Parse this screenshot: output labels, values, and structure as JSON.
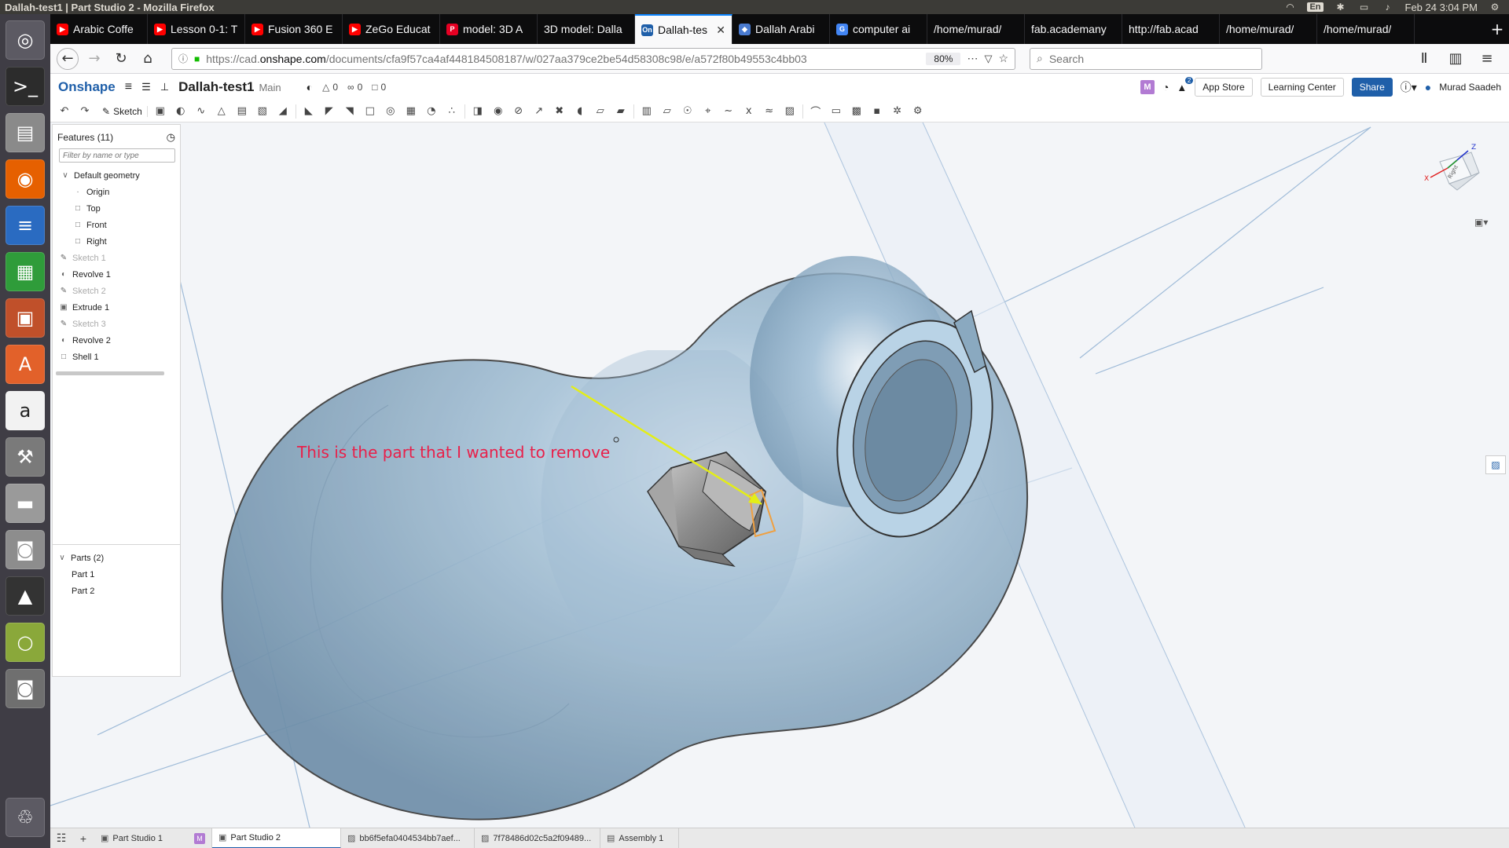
{
  "window": {
    "title": "Dallah-test1 | Part Studio 2 - Mozilla Firefox"
  },
  "tray": {
    "lang": "En",
    "datetime": "Feb 24  3:04 PM"
  },
  "tabs": [
    {
      "label": "Arabic Coffe",
      "favicon": "youtube-icon",
      "color": "#ff0000"
    },
    {
      "label": "Lesson 0-1: T",
      "favicon": "youtube-icon",
      "color": "#ff0000"
    },
    {
      "label": "Fusion 360 E",
      "favicon": "youtube-icon",
      "color": "#ff0000"
    },
    {
      "label": "ZeGo Educat",
      "favicon": "youtube-icon",
      "color": "#ff0000"
    },
    {
      "label": "model: 3D A",
      "favicon": "pinterest-icon",
      "color": "#e60023"
    },
    {
      "label": "3D model: Dalla",
      "favicon": "",
      "color": ""
    },
    {
      "label": "Dallah-tes",
      "favicon": "onshape-icon",
      "color": "#1f5fa9",
      "active": true
    },
    {
      "label": "Dallah Arabi",
      "favicon": "generic-icon",
      "color": "#4a7bd0"
    },
    {
      "label": "computer ai",
      "favicon": "google-icon",
      "color": "#4285f4"
    },
    {
      "label": "/home/murad/",
      "favicon": "",
      "color": ""
    },
    {
      "label": "fab.academany",
      "favicon": "",
      "color": ""
    },
    {
      "label": "http://fab.acad",
      "favicon": "",
      "color": ""
    },
    {
      "label": "/home/murad/",
      "favicon": "",
      "color": ""
    },
    {
      "label": "/home/murad/",
      "favicon": "",
      "color": ""
    }
  ],
  "nav": {
    "url_prefix": "https://cad.",
    "url_domain": "onshape.com",
    "url_rest": "/documents/cfa9f57ca4af448184508187/w/027aa379ce2be54d58308c98/e/a572f80b49553c4bb03",
    "zoom": "80%",
    "search_placeholder": "Search"
  },
  "onshape": {
    "logo": "Onshape",
    "doc_title": "Dallah-test1",
    "branch": "Main",
    "likes": "0",
    "links": "0",
    "copies": "0",
    "app_store": "App Store",
    "learning_center": "Learning Center",
    "share": "Share",
    "user": "Murad Saadeh",
    "m_badge": "M",
    "notif_count": "2"
  },
  "toolbar": {
    "sketch_label": "Sketch"
  },
  "features": {
    "header": "Features (11)",
    "filter_placeholder": "Filter by name or type",
    "default_geometry": "Default geometry",
    "geometry_items": [
      "Origin",
      "Top",
      "Front",
      "Right"
    ],
    "items": [
      {
        "label": "Sketch 1",
        "muted": true,
        "icon": "sketch-icon"
      },
      {
        "label": "Revolve 1",
        "muted": false,
        "icon": "revolve-icon"
      },
      {
        "label": "Sketch 2",
        "muted": true,
        "icon": "sketch-icon"
      },
      {
        "label": "Extrude 1",
        "muted": false,
        "icon": "extrude-icon"
      },
      {
        "label": "Sketch 3",
        "muted": true,
        "icon": "sketch-icon"
      },
      {
        "label": "Revolve 2",
        "muted": false,
        "icon": "revolve-icon"
      },
      {
        "label": "Shell 1",
        "muted": false,
        "icon": "shell-icon"
      }
    ],
    "parts_header": "Parts (2)",
    "parts": [
      "Part 1",
      "Part 2"
    ]
  },
  "annotation": {
    "text": "This is the part that I wanted to remove",
    "text_color": "#e8204a",
    "arrow_color": "#e4ee16"
  },
  "viewcube": {
    "face_label": "Right",
    "axis_z": "Z",
    "axis_x": "X"
  },
  "bottom_tabs": [
    {
      "label": "Part Studio 1",
      "icon": "part-studio-icon"
    },
    {
      "label": "Part Studio 2",
      "icon": "part-studio-icon",
      "active": true
    },
    {
      "label": "bb6f5efa0404534bb7aef...",
      "icon": "image-icon"
    },
    {
      "label": "7f78486d02c5a2f09489...",
      "icon": "image-icon"
    },
    {
      "label": "Assembly 1",
      "icon": "assembly-icon"
    }
  ],
  "colors": {
    "accent": "#1f5fa9",
    "part_body": "#8fb0c8"
  }
}
